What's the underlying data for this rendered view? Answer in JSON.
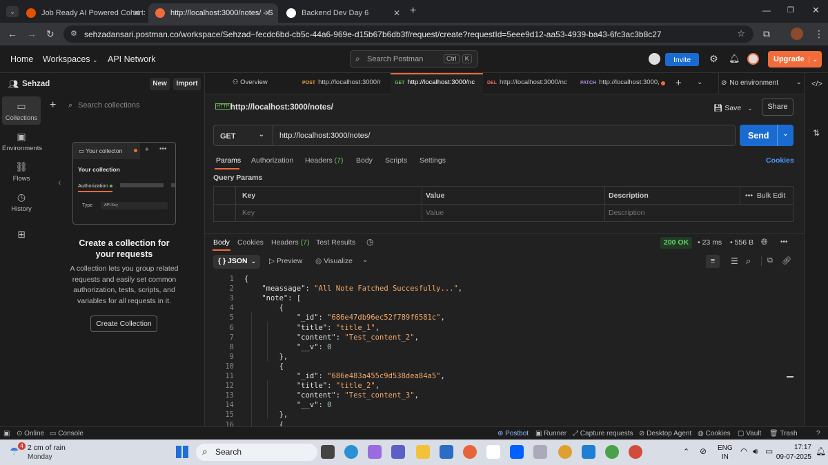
{
  "browser": {
    "tabs": [
      {
        "title": "Job Ready AI Powered Cohort: W",
        "color": "#e65100"
      },
      {
        "title": "http://localhost:3000/notes/ - S",
        "color": "#f26b3a"
      },
      {
        "title": "Backend Dev Day 6",
        "color": "#ffffff"
      }
    ],
    "url": "sehzadansari.postman.co/workspace/Sehzad~fecdc6bd-cb5c-44a6-969e-d15b67b6db3f/request/create?requestId=5eee9d12-aa53-4939-ba43-6fc3ac3b8c27"
  },
  "header": {
    "home": "Home",
    "workspaces": "Workspaces",
    "api_network": "API Network",
    "search_placeholder": "Search Postman",
    "kbd1": "Ctrl",
    "kbd2": "K",
    "invite": "Invite",
    "upgrade": "Upgrade"
  },
  "sidebar": {
    "user": "Sehzad",
    "new": "New",
    "import": "Import",
    "search_placeholder": "Search collections",
    "nav": [
      {
        "label": "Collections",
        "icon": "collections-icon"
      },
      {
        "label": "Environments",
        "icon": "environments-icon"
      },
      {
        "label": "Flows",
        "icon": "flows-icon"
      },
      {
        "label": "History",
        "icon": "history-icon"
      }
    ],
    "preview": {
      "tab": "Your collecton",
      "title": "Your collection",
      "auth": "Authorization",
      "type": "Type",
      "type_value": "API Key"
    },
    "empty_title": "Create a collection for your requests",
    "empty_body": "A collection lets you group related requests and easily set common authorization, tests, scripts, and variables for all requests in it.",
    "create_button": "Create Collection"
  },
  "request_tabs": {
    "overview": "Overview",
    "tabs": [
      {
        "method": "POST",
        "method_color": "#f2a93b",
        "label": "http://localhost:3000/r"
      },
      {
        "method": "GET",
        "method_color": "#6bbd5b",
        "label": "http://localhost:3000/nc"
      },
      {
        "method": "DEL",
        "method_color": "#e8675a",
        "label": "http://localhost:3000/nc"
      },
      {
        "method": "PATCH",
        "method_color": "#b38ee0",
        "label": "http://localhost:3000,"
      }
    ],
    "environment": "No environment"
  },
  "request": {
    "title": "http://localhost:3000/notes/",
    "save": "Save",
    "share": "Share",
    "method": "GET",
    "url": "http://localhost:3000/notes/",
    "send": "Send",
    "subtabs": [
      "Params",
      "Authorization",
      "Headers",
      "Body",
      "Scripts",
      "Settings"
    ],
    "headers_count": "(7)",
    "cookies": "Cookies",
    "query_params": "Query Params",
    "table_headers": [
      "Key",
      "Value",
      "Description"
    ],
    "bulk_edit": "Bulk Edit",
    "placeholders": [
      "Key",
      "Value",
      "Description"
    ]
  },
  "response": {
    "tabs": [
      "Body",
      "Cookies",
      "Headers",
      "Test Results"
    ],
    "headers_count": "(7)",
    "status": "200 OK",
    "time": "23 ms",
    "size": "556 B",
    "format": "JSON",
    "preview": "Preview",
    "visualize": "Visualize",
    "lines": [
      {
        "n": "1",
        "text": "{"
      },
      {
        "n": "2",
        "text": "    \"meassage\": \"All Note Fatched Succesfully...\","
      },
      {
        "n": "3",
        "text": "    \"note\": ["
      },
      {
        "n": "4",
        "text": "        {"
      },
      {
        "n": "5",
        "text": "            \"_id\": \"686e47db96ec52f789f6581c\","
      },
      {
        "n": "6",
        "text": "            \"title\": \"title_1\","
      },
      {
        "n": "7",
        "text": "            \"content\": \"Test_content_2\","
      },
      {
        "n": "8",
        "text": "            \"__v\": 0"
      },
      {
        "n": "9",
        "text": "        },"
      },
      {
        "n": "10",
        "text": "        {"
      },
      {
        "n": "11",
        "text": "            \"_id\": \"686e483a455c9d538dea84a5\","
      },
      {
        "n": "12",
        "text": "            \"title\": \"title_2\","
      },
      {
        "n": "13",
        "text": "            \"content\": \"Test_content_3\","
      },
      {
        "n": "14",
        "text": "            \"__v\": 0"
      },
      {
        "n": "15",
        "text": "        },"
      },
      {
        "n": "16",
        "text": "        {"
      }
    ]
  },
  "statusbar": {
    "online": "Online",
    "console": "Console",
    "postbot": "Postbot",
    "runner": "Runner",
    "capture": "Capture requests",
    "desktop_agent": "Desktop Agent",
    "cookies": "Cookies",
    "vault": "Vault",
    "trash": "Trash"
  },
  "taskbar": {
    "weather_badge": "4",
    "weather": "2 cm of rain",
    "day": "Monday",
    "search": "Search",
    "lang1": "ENG",
    "lang2": "IN",
    "time": "17:17",
    "date": "09-07-2025"
  }
}
